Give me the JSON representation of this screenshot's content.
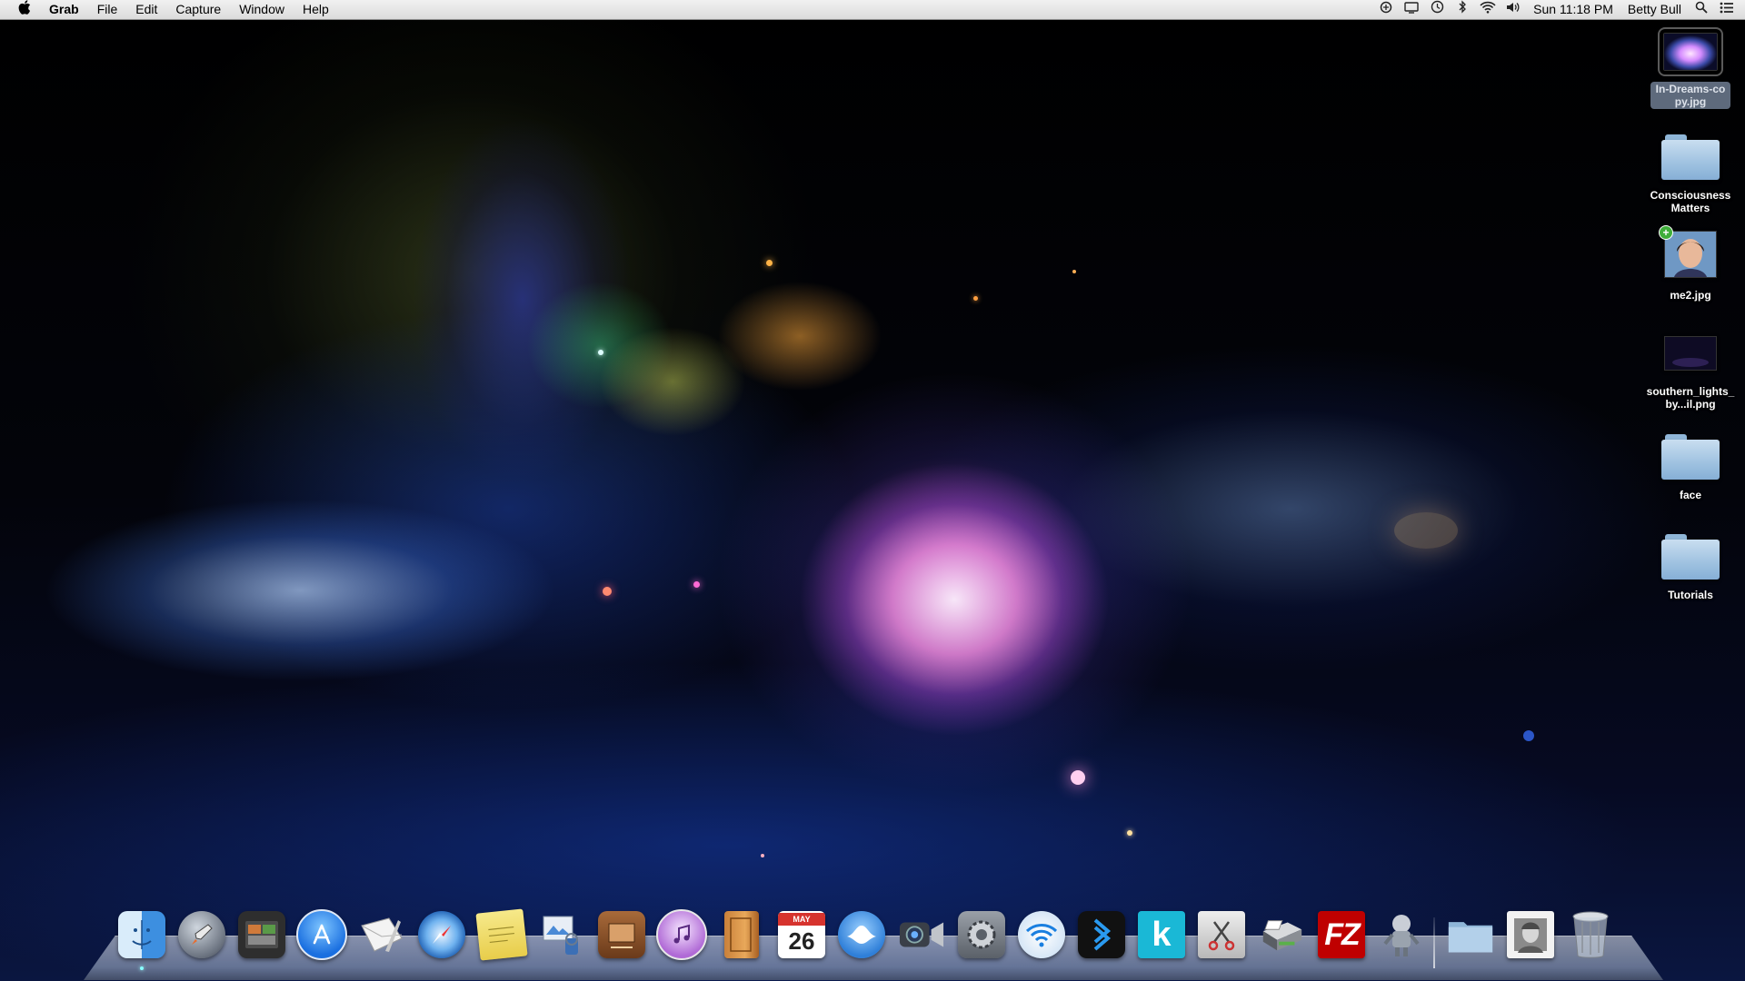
{
  "menubar": {
    "apple": "",
    "app_name": "Grab",
    "menus": [
      "File",
      "Edit",
      "Capture",
      "Window",
      "Help"
    ],
    "status_icons": [
      "sync-icon",
      "display-icon",
      "time-machine-icon",
      "bluetooth-icon",
      "wifi-icon",
      "volume-icon"
    ],
    "clock": "Sun 11:18 PM",
    "user": "Betty Bull",
    "spotlight": "spotlight-icon",
    "notifications": "notification-center-icon"
  },
  "desktop": {
    "items": [
      {
        "label": "In-Dreams-copy.jpg",
        "type": "image",
        "selected": true
      },
      {
        "label": "Consciousness Matters",
        "type": "folder"
      },
      {
        "label": "me2.jpg",
        "type": "image"
      },
      {
        "label": "southern_lights_by...il.png",
        "type": "image"
      },
      {
        "label": "face",
        "type": "folder"
      },
      {
        "label": "Tutorials",
        "type": "folder"
      }
    ]
  },
  "dock": {
    "calendar_month": "MAY",
    "calendar_day": "26",
    "filezilla_label": "FZ",
    "kindle_label": "k",
    "items": [
      "Finder",
      "Launchpad",
      "Photo Booth",
      "App Store",
      "Mail",
      "Safari",
      "Stickies",
      "Preview",
      "Photo Slideshow",
      "iTunes",
      "iBooks",
      "Calendar",
      "Mail Client",
      "FaceTime",
      "System Preferences",
      "Wi-Fi",
      "Deezer",
      "Kindle",
      "Scissors",
      "Printer",
      "FileZilla",
      "Automator",
      "Documents",
      "Photo",
      "Trash"
    ]
  }
}
